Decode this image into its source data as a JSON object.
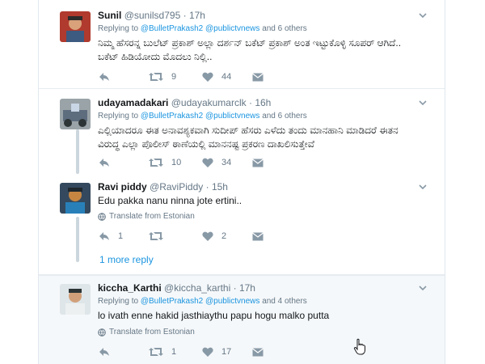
{
  "tweets": [
    {
      "name": "Sunil",
      "handle": "@sunilsd795",
      "sep": "·",
      "time": "17h",
      "replying_prefix": "Replying to",
      "replying_to": "@BulletPrakash2 @publictvnews",
      "replying_suffix": "and 6 others",
      "text_lines": [
        "ನಿಮ್ಮ ಹೆಸರನ್ನ ಬುಲೆಟ್ ಪ್ರಕಾಶ್ ಅಲ್ಲಾ ದರ್ಶನ್ ಬಕೆಟ್ ಪ್ರಕಾಶ್ ಅಂತ ಇಟ್ಟುಕೊಳ್ಳಿ ಸೂಪರ್ ಆಗಿದೆ..",
        "ಬಕೆಟ್ ಹಿಡಿಯೋದು ಮೊದಲು ನಿಲ್ಲಿ.."
      ],
      "retweets": "9",
      "likes": "44",
      "avatar_color": "#c0392b"
    },
    {
      "name": "udayamadakari",
      "handle": "@udayakumarclk",
      "sep": "·",
      "time": "16h",
      "replying_prefix": "Replying to",
      "replying_to": "@BulletPrakash2 @publictvnews",
      "replying_suffix": "and 6 others",
      "text_lines": [
        "ಎಲ್ಲಿಯಾದರೂ ಈತ ಅನಾವಶ್ಯಕವಾಗಿ ಸುದೀಪ್ ಹೆಸರು ಎಳೆದು ತಂದು ಮಾನಹಾನಿ ಮಾಡಿದರೆ ಈತನ",
        "ವಿರುದ್ಧ ಎಲ್ಲಾ ಪೊಲೀಸ್ ಠಾಣೆಯಲ್ಲಿ ಮಾನನಷ್ಟ ಪ್ರಕರಣ ದಾಖಲಿಸುತ್ತೇವೆ"
      ],
      "retweets": "10",
      "likes": "34",
      "avatar_color": "#7f8c8d"
    },
    {
      "name": "Ravi piddy",
      "handle": "@RaviPiddy",
      "sep": "·",
      "time": "15h",
      "text_lines": [
        "Edu pakka nanu ninna jote ertini.."
      ],
      "translate": "Translate from Estonian",
      "replies": "1",
      "likes": "2",
      "avatar_color": "#2c3e50"
    },
    {
      "name": "kiccha_Karthi",
      "handle": "@kiccha_karthi",
      "sep": "·",
      "time": "17h",
      "replying_prefix": "Replying to",
      "replying_to": "@BulletPrakash2 @publictvnews",
      "replying_suffix": "and 4 others",
      "text_lines": [
        "lo ivath enne hakid jasthiaythu papu hogu malko putta"
      ],
      "translate": "Translate from Estonian",
      "retweets": "1",
      "likes": "17",
      "avatar_color": "#95a5a6"
    }
  ],
  "more_reply": "1 more reply",
  "colors": {
    "link": "#1b95e0",
    "muted": "#657786",
    "thread": "#ccd6dd"
  }
}
